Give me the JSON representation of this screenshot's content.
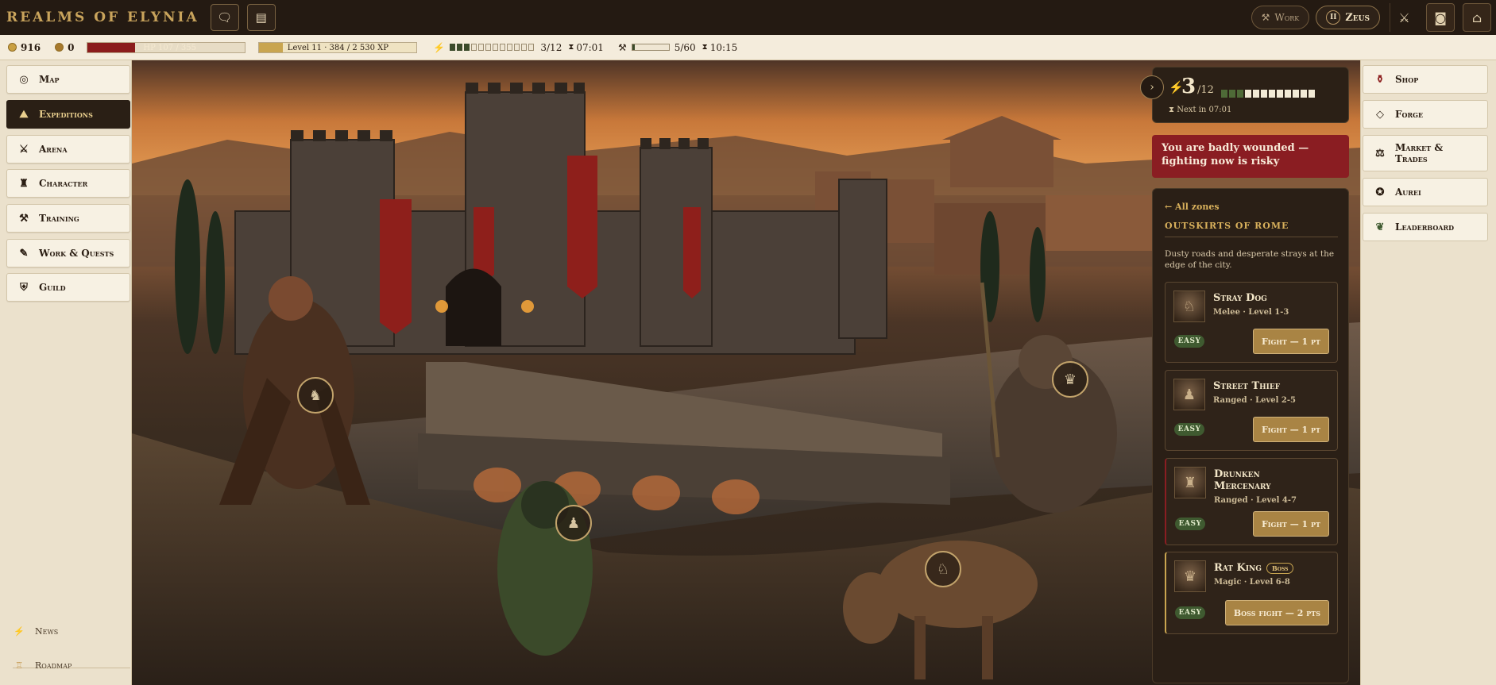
{
  "app": {
    "title": "REALMS OF ELYNIA"
  },
  "topbar": {
    "chat_icon": "chat-icon",
    "journal_icon": "book-icon",
    "work_label": "Work",
    "user_label": "Zeus",
    "user_badge": "II",
    "icons": [
      "sword-icon",
      "discord-icon",
      "door-icon"
    ]
  },
  "stats": {
    "gold": "916",
    "aurei": "0",
    "hp_text": "HP 107 / 355",
    "hp_fraction": 0.3,
    "xp_text": "Level 11 · 384 / 2 530 XP",
    "xp_fraction": 0.15,
    "energy_text": "3/12",
    "energy_on": 3,
    "energy_total": 12,
    "energy_timer": "07:01",
    "work_text": "5/60",
    "work_fraction": 0.08,
    "work_timer": "10:15"
  },
  "leftnav": {
    "items": [
      {
        "label": "Map",
        "icon": "compass-icon",
        "glyph": "◎"
      },
      {
        "label": "Expeditions",
        "icon": "map-icon",
        "glyph": "⛰"
      },
      {
        "label": "Arena",
        "icon": "crossed-swords-icon",
        "glyph": "⚔"
      },
      {
        "label": "Character",
        "icon": "helmet-icon",
        "glyph": "♜"
      },
      {
        "label": "Training",
        "icon": "anvil-icon",
        "glyph": "⚒"
      },
      {
        "label": "Work & Quests",
        "icon": "scroll-icon",
        "glyph": "✎"
      },
      {
        "label": "Guild",
        "icon": "shield-icon",
        "glyph": "⛨"
      }
    ],
    "footer": [
      {
        "label": "News",
        "icon": "bolt-icon",
        "glyph": "⚡"
      },
      {
        "label": "Roadmap",
        "icon": "pillar-icon",
        "glyph": "♖"
      }
    ]
  },
  "rightnav": {
    "items": [
      {
        "label": "Shop",
        "icon": "bag-icon",
        "glyph": "⚱"
      },
      {
        "label": "Forge",
        "icon": "gem-icon",
        "glyph": "◇"
      },
      {
        "label": "Market & Trades",
        "icon": "scales-icon",
        "glyph": "⚖"
      },
      {
        "label": "Aurei",
        "icon": "aurei-coin-icon",
        "glyph": "✪"
      },
      {
        "label": "Leaderboard",
        "icon": "laurel-icon",
        "glyph": "❦"
      }
    ]
  },
  "energy_card": {
    "current": "3",
    "max": "/12",
    "next_label": "Next in 07:01",
    "on": 3,
    "total": 12
  },
  "warning": "You are badly wounded — fighting now is risky",
  "zone": {
    "back_label": "← All zones",
    "title": "OUTSKIRTS OF ROME",
    "description": "Dusty roads and desperate strays at the edge of the city.",
    "enemies": [
      {
        "name": "Stray Dog",
        "sub": "Melee · Level 1-3",
        "difficulty": "EASY",
        "action": "Fight — 1 pt",
        "boss": false
      },
      {
        "name": "Street Thief",
        "sub": "Ranged · Level 2-5",
        "difficulty": "EASY",
        "action": "Fight — 1 pt",
        "boss": false
      },
      {
        "name": "Drunken Mercenary",
        "sub": "Ranged · Level 4-7",
        "difficulty": "EASY",
        "action": "Fight — 1 pt",
        "boss": false
      },
      {
        "name": "Rat King",
        "sub": "Magic · Level 6-8",
        "difficulty": "EASY",
        "action": "Boss fight — 2 pts",
        "boss": true,
        "boss_tag": "Boss"
      }
    ]
  },
  "colors": {
    "topbar": "#241a12",
    "accent_gold": "#c9a45c",
    "hp_red": "#8b1c1c",
    "warning_red": "#8a1d22",
    "easy_green": "#3f5a30"
  }
}
